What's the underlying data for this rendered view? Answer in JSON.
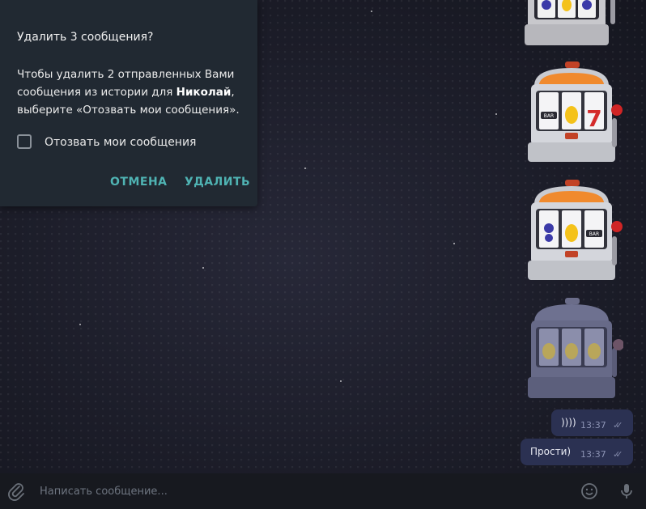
{
  "dialog": {
    "title": "Удалить 3 сообщения?",
    "body_prefix": "Чтобы удалить 2 отправленных Вами сообщения из истории для ",
    "body_name": "Николай",
    "body_suffix": ", выберите «Отозвать мои сообщения».",
    "checkbox_label": "Отозвать мои сообщения",
    "checkbox_checked": false,
    "cancel_label": "ОТМЕНА",
    "delete_label": "УДАЛИТЬ"
  },
  "messages": [
    {
      "text": "))))",
      "time": "13:37",
      "status": "read"
    },
    {
      "text": "Прости)",
      "time": "13:37",
      "status": "read"
    }
  ],
  "slots": [
    {
      "reels": [
        "grapes",
        "lemon",
        "grapes"
      ],
      "active": true
    },
    {
      "reels": [
        "bar",
        "lemon",
        "seven"
      ],
      "active": true
    },
    {
      "reels": [
        "grapes",
        "lemon",
        "bar"
      ],
      "active": true
    },
    {
      "reels": [
        "lemon",
        "lemon",
        "lemon"
      ],
      "active": false
    }
  ],
  "composer": {
    "placeholder": "Написать сообщение...",
    "attach_icon": "paperclip-icon",
    "emoji_icon": "smile-icon",
    "voice_icon": "microphone-icon"
  },
  "colors": {
    "accent": "#4fb3b3",
    "bubble": "#2b3152",
    "dialog": "#212932"
  }
}
